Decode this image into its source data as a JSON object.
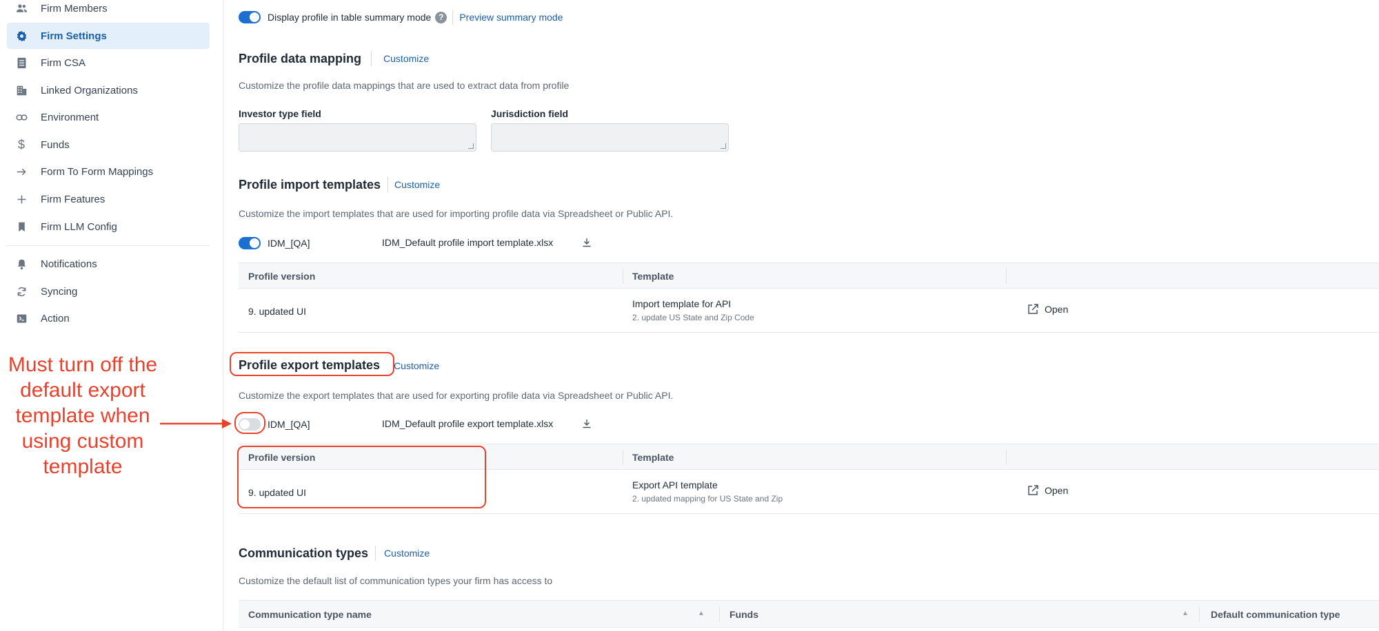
{
  "sidebar": {
    "items": [
      {
        "label": "Firm Members",
        "icon": "users-icon"
      },
      {
        "label": "Firm Settings",
        "icon": "gear-icon",
        "active": true
      },
      {
        "label": "Firm CSA",
        "icon": "document-icon"
      },
      {
        "label": "Linked Organizations",
        "icon": "building-icon"
      },
      {
        "label": "Environment",
        "icon": "link-icon"
      },
      {
        "label": "Funds",
        "icon": "dollar-icon"
      },
      {
        "label": "Form To Form Mappings",
        "icon": "arrow-right-icon"
      },
      {
        "label": "Firm Features",
        "icon": "plus-icon"
      },
      {
        "label": "Firm LLM Config",
        "icon": "bookmark-icon"
      },
      {
        "label": "Notifications",
        "icon": "bell-icon"
      },
      {
        "label": "Syncing",
        "icon": "sync-icon"
      },
      {
        "label": "Action",
        "icon": "terminal-icon"
      }
    ]
  },
  "annotation": {
    "text": "Must turn off the default export template when using custom template",
    "color": "#e8412c"
  },
  "summary_mode": {
    "toggle_on": true,
    "label": "Display profile in table summary mode",
    "preview_link": "Preview summary mode"
  },
  "profile_data_mapping": {
    "title": "Profile data mapping",
    "customize": "Customize",
    "description": "Customize the profile data mappings that are used to extract data from profile",
    "investor_type_label": "Investor type field",
    "jurisdiction_label": "Jurisdiction field"
  },
  "import_templates": {
    "title": "Profile import templates",
    "customize": "Customize",
    "description": "Customize the import templates that are used for importing profile data via Spreadsheet or Public API.",
    "toggle_on": true,
    "toggle_label": "IDM_[QA]",
    "file_name": "IDM_Default profile import template.xlsx",
    "headers": [
      "Profile version",
      "Template"
    ],
    "row": {
      "version": "9. updated UI",
      "template": "Import template for API",
      "template_sub": "2. update US State and Zip Code",
      "open": "Open"
    }
  },
  "export_templates": {
    "title": "Profile export templates",
    "customize": "Customize",
    "description": "Customize the export templates that are used for exporting profile data via Spreadsheet or Public API.",
    "toggle_on": false,
    "toggle_label": "IDM_[QA]",
    "file_name": "IDM_Default profile export template.xlsx",
    "headers": [
      "Profile version",
      "Template"
    ],
    "row": {
      "version": "9. updated UI",
      "template": "Export API template",
      "template_sub": "2. updated mapping for US State and Zip",
      "open": "Open"
    }
  },
  "communication_types": {
    "title": "Communication types",
    "customize": "Customize",
    "description": "Customize the default list of communication types your firm has access to",
    "headers": [
      "Communication type name",
      "Funds",
      "Default communication type"
    ]
  },
  "colors": {
    "accent": "#1b6fd0",
    "link": "#1b5fa8",
    "active_bg": "#e3f0fb",
    "annotation": "#e8412c"
  }
}
